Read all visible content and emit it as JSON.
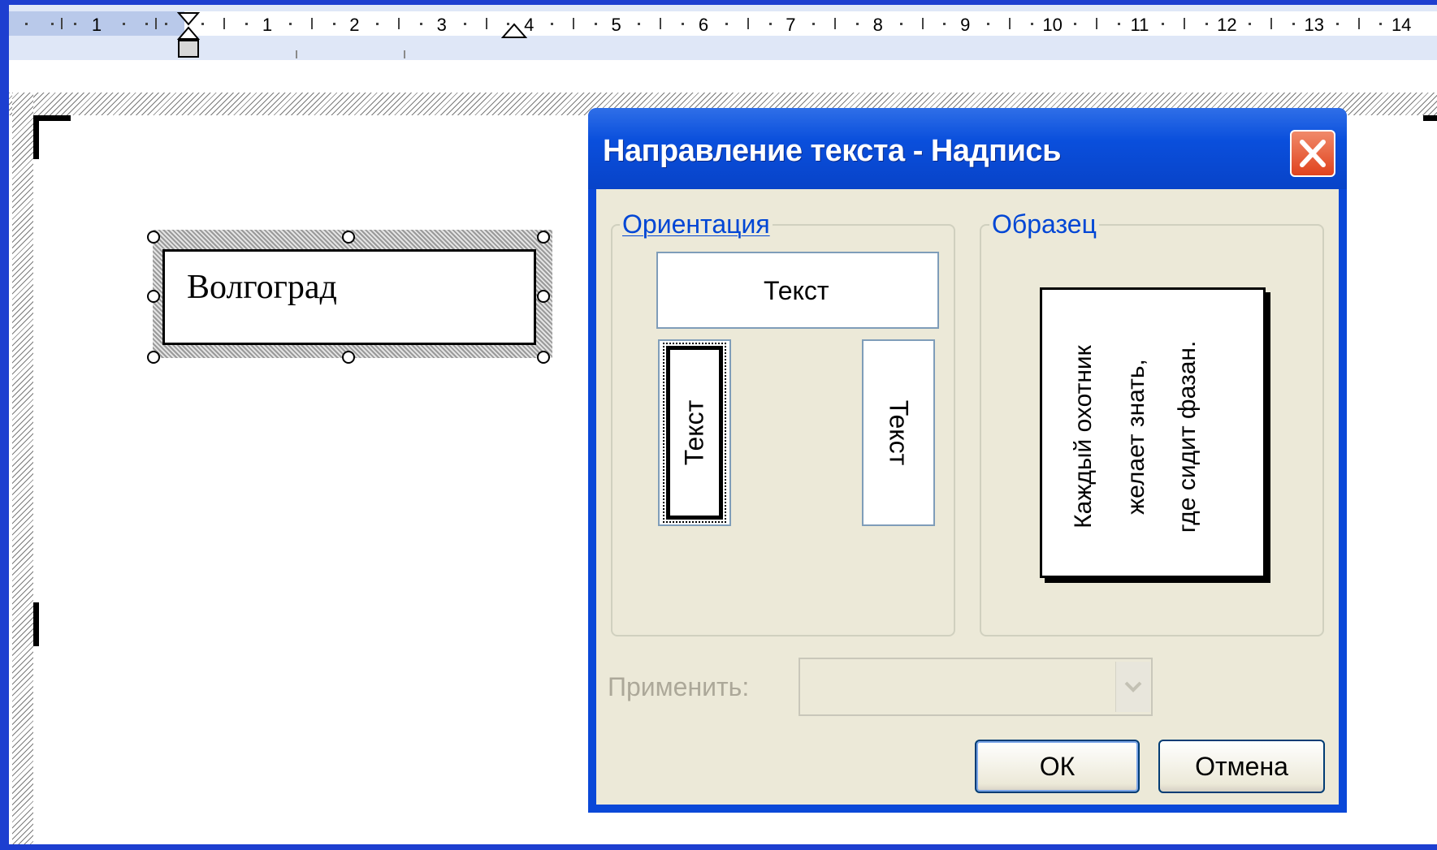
{
  "ruler": {
    "left_numbers": [
      "1",
      "1",
      "2",
      "3"
    ],
    "right_numbers": [
      "4",
      "5",
      "6",
      "7",
      "8",
      "9",
      "10",
      "11",
      "12",
      "13",
      "14"
    ]
  },
  "document": {
    "textbox_text": "Волгоград"
  },
  "dialog": {
    "title": "Направление текста - Надпись",
    "close_icon": "close-icon",
    "orientation_group": {
      "label": "Ориентация",
      "options": [
        "Текст",
        "Текст",
        "Текст"
      ],
      "selected_index": 1
    },
    "sample_group": {
      "label": "Образец",
      "lines": [
        "Каждый охотник",
        "желает знать,",
        "где сидит фазан."
      ]
    },
    "apply": {
      "label": "Применить:",
      "value": ""
    },
    "ok_label": "ОК",
    "cancel_label": "Отмена"
  },
  "colors": {
    "title_bar": "#0a48d8",
    "dialog_body": "#ece9d8",
    "group_label": "#0046d5",
    "close_button": "#e0431e"
  }
}
